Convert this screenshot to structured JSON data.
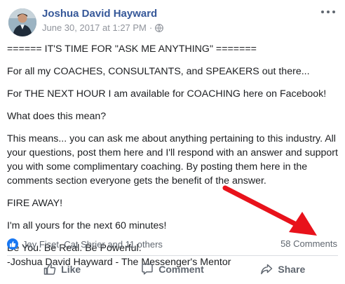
{
  "post": {
    "author": "Joshua David Hayward",
    "timestamp": "June 30, 2017 at 1:27 PM",
    "separator": "·",
    "privacy_icon": "globe-icon",
    "paragraphs": [
      "====== IT'S TIME FOR \"ASK ME ANYTHING\" =======",
      "For all my COACHES, CONSULTANTS, and SPEAKERS out there...",
      "For THE NEXT HOUR I am available for COACHING here on Facebook!",
      "What does this mean?",
      "This means... you can ask me about anything pertaining to this industry. All your questions, post them here and I'll respond with an answer and support you with some complimentary coaching. By posting them here in the comments section everyone gets the benefit of the answer.",
      "FIRE AWAY!",
      "I'm all yours for the next 60 minutes!"
    ],
    "signature_line1": "Be You. Be Real. Be Powerful.",
    "signature_line2": "-Joshua David Hayward - The Messenger's Mentor"
  },
  "reactions": {
    "icon": "like-reaction-icon",
    "text": "Jay Fiset, Cat Shrier and 11 others"
  },
  "comments_count": "58 Comments",
  "actions": {
    "like": "Like",
    "comment": "Comment",
    "share": "Share"
  },
  "colors": {
    "author": "#365899",
    "meta": "#90949c",
    "annotation_arrow": "#e8121b",
    "like_blue": "#1877f2"
  }
}
